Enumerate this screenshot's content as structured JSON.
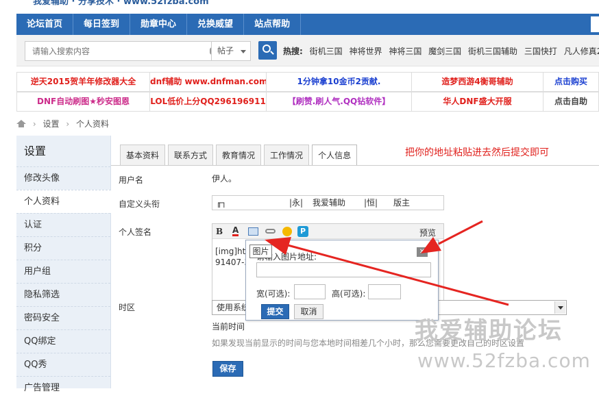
{
  "top_strip_text": "我爱辅助 · 分享技术 · www.52fzba.com",
  "nav": [
    "论坛首页",
    "每日签到",
    "勋章中心",
    "兑换威望",
    "站点帮助"
  ],
  "search": {
    "placeholder": "请输入搜索内容",
    "type": "帖子",
    "hot_label": "热搜:",
    "hot_items": [
      "街机三国",
      "神将世界",
      "神将三国",
      "魔剑三国",
      "街机三国辅助",
      "三国快打",
      "凡人修真2"
    ]
  },
  "ads": {
    "row1": [
      "逆天2015贺羊年修改器大全",
      "dnf辅助 www.dnfman.com",
      "1分钟拿10金币2贡献.",
      "造梦西游4衡哥辅助",
      "点击购买"
    ],
    "row2": [
      "DNF自动刷图★秒安图恩",
      "LOL低价上分QQ296196911",
      "【刷赞.刷人气.QQ钻软件】",
      "华人DNF盛大开服",
      "点击自助"
    ],
    "colors": {
      "row1": [
        "#e0201c",
        "#e0201c",
        "#1a3fd0",
        "#e0201c",
        "#1a3fd0"
      ],
      "row2": [
        "#cc2c8a",
        "#e0201c",
        "#b030c0",
        "#e0201c",
        "#444444"
      ]
    }
  },
  "breadcrumb": [
    "设置",
    "个人资料"
  ],
  "sidebar": {
    "title": "设置",
    "items": [
      "修改头像",
      "个人资料",
      "认证",
      "积分",
      "用户组",
      "隐私筛选",
      "密码安全",
      "QQ绑定",
      "QQ秀",
      "广告管理"
    ]
  },
  "tabs": [
    "基本资料",
    "联系方式",
    "教育情况",
    "工作情况",
    "个人信息"
  ],
  "instruction_note": "把你的地址粘贴进去然后提交即可",
  "form": {
    "username_label": "用户名",
    "username_value": "伊人。",
    "custom_title_label": "自定义头衔",
    "custom_title_parts": [
      "╓┐",
      "|永|",
      "我爱辅助",
      "|恒|",
      "版主"
    ],
    "signature_label": "个人签名",
    "toolbar": {
      "bold": "B",
      "color": "A",
      "preview": "预览"
    },
    "signature_text_line1": "[img]htt",
    "signature_text_line2": "91407-3",
    "timezone_label": "时区",
    "timezone_value": "使用系统",
    "current_time_label": "当前时间",
    "timezone_hint": "如果发现当前显示的时间与您本地时间相差几个小时，那么您需要更改自己的时区设置",
    "save_button": "保存"
  },
  "image_popup": {
    "tooltip": "图片",
    "url_label": "请输入图片地址:",
    "width_label": "宽(可选):",
    "height_label": "高(可选):",
    "submit": "提交",
    "cancel": "取消"
  },
  "watermark": {
    "line1": "我爱辅助论坛",
    "line2": "www.52fzba.com"
  },
  "colors": {
    "nav_blue": "#2b6bb5",
    "note_red": "#e0201c",
    "arrow_red": "#e52521"
  }
}
